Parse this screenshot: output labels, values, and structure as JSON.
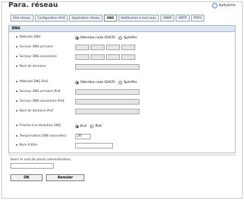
{
  "page": {
    "title": "Para. réseau",
    "refresh_label": "Rafraîchir"
  },
  "tabs": [
    "Etat réseau",
    "Configuration IPv6",
    "Application réseau",
    "DNS",
    "Notification e-mail auto",
    "SNMP",
    "SMTP",
    "POP3"
  ],
  "section": {
    "title": "DNS"
  },
  "fields": {
    "dns_method": {
      "label": "Méthode DNS",
      "opt_auto": "Obtention auto (DHCP)",
      "opt_specify": "Spécifier"
    },
    "dns_primary": {
      "label": "Serveur DNS primaire"
    },
    "dns_secondary": {
      "label": "Serveur DNS secondaire"
    },
    "domain_name": {
      "label": "Nom de domaine"
    },
    "dns_method_v6": {
      "label": "Méthode DNS IPv6",
      "opt_auto": "Obtention auto (DHCP)",
      "opt_specify": "Spécifier"
    },
    "dns_primary_v6": {
      "label": "Serveur DNS primaire IPv6"
    },
    "dns_secondary_v6": {
      "label": "Serveur DNS secondaire IPv6"
    },
    "domain_name_v6": {
      "label": "Nom de domaine IPv6"
    },
    "resolution_priority": {
      "label": "Priorité à la résolution DNS",
      "opt_ipv4": "IPv4",
      "opt_ipv6": "IPv6"
    },
    "dns_timeout": {
      "label": "Temporisation DNS (secondes)",
      "value": "20"
    },
    "hostname": {
      "label": "Nom d'hôte",
      "value": ""
    }
  },
  "admin": {
    "label": "Saisir le mot de passe administrateur.",
    "value": ""
  },
  "buttons": {
    "ok": "OK",
    "cancel": "Annuler"
  }
}
